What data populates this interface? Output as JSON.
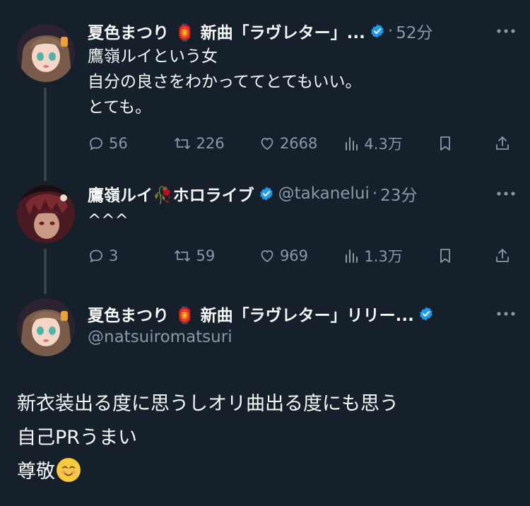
{
  "tweets": [
    {
      "name": "夏色まつり 🏮 新曲「ラヴレター」...",
      "time": "52分",
      "text": "鷹嶺ルイという女\n自分の良さをわかっててとてもいい。\nとても。",
      "replies": "56",
      "retweets": "226",
      "likes": "2668",
      "views": "4.3万"
    },
    {
      "name": "鷹嶺ルイ🥀ホロライブ",
      "handle": "@takanelui",
      "time": "23分",
      "text": "^^^",
      "replies": "3",
      "retweets": "59",
      "likes": "969",
      "views": "1.3万"
    }
  ],
  "main": {
    "name": "夏色まつり 🏮 新曲「ラヴレター」リリー...",
    "handle": "@natsuiromatsuri",
    "text": "新衣装出る度に思うしオリ曲出る度にも思う\n自己PRうまい\n尊敬",
    "emoji": "☺️"
  },
  "colors": {
    "background": "#15202b",
    "text": "#f7f9f9",
    "secondary": "#8b98a5",
    "verified": "#1d9bf0",
    "thread_line": "#38444d"
  },
  "icons": [
    "verified-badge-icon",
    "more-icon",
    "reply-icon",
    "retweet-icon",
    "like-icon",
    "views-icon",
    "bookmark-icon",
    "share-icon"
  ]
}
